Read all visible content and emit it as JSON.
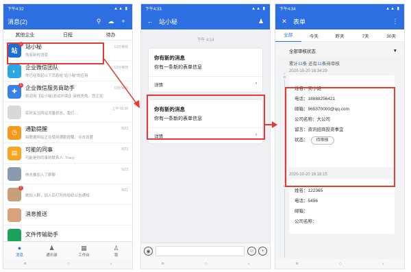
{
  "p1": {
    "status": {
      "time": "下午4:32"
    },
    "title": "消息(2)",
    "subbar": [
      "其他企业",
      "日程",
      "待办"
    ],
    "items": [
      {
        "name": "站小秘",
        "preview": "你有新的消息",
        "time": "13分钟前",
        "avatar": "站",
        "color": "#1a6fd6",
        "badge": "1"
      },
      {
        "name": "企业微信团队",
        "preview": "你已经发起以下消息给“站小秘”的应用",
        "time": "13分钟前",
        "avatar": "◐",
        "color": "#2aa6e0",
        "badge": ""
      },
      {
        "name": "企业微信服务商助手",
        "preview": "欢迎用【站小秘(测试环境)】审核失败，您正在",
        "time": "13分钟前",
        "avatar": "✚",
        "color": "#3b82e6",
        "badge": "1"
      },
      {
        "name": "",
        "preview": "实时关注网站流量状态，我们...",
        "time": "上午 11:36",
        "avatar": "",
        "color": "#d8d8d8",
        "badge": ""
      },
      {
        "name": "通勤提醒",
        "preview": "由数据网站正在使用通勤提醒，点击设置",
        "time": "9/23",
        "avatar": "◷",
        "color": "#f59a1b",
        "badge": ""
      },
      {
        "name": "可能的同事",
        "preview": "可能是你同事的联系人: Tracy",
        "time": "9/23",
        "avatar": "▤",
        "color": "#f5a623",
        "badge": ""
      },
      {
        "name": "",
        "preview": "林夫推加入了群聊",
        "time": "9/23",
        "avatar": "",
        "color": "#8a9bb0",
        "badge": ""
      },
      {
        "name": "",
        "preview": "她加入群，加入后打开的组织公告通知",
        "time": "9/21",
        "avatar": "",
        "color": "#c7a07a",
        "badge": "1"
      },
      {
        "name": "消息推送",
        "preview": "",
        "time": "",
        "avatar": "",
        "color": "#d9a27c",
        "badge": ""
      },
      {
        "name": "文件传输助手",
        "preview": "",
        "time": "",
        "avatar": "",
        "color": "#19a35b",
        "badge": ""
      }
    ],
    "tabs": [
      {
        "label": "消息",
        "icon": "●"
      },
      {
        "label": "通讯录",
        "icon": "♟"
      },
      {
        "label": "工作台",
        "icon": "▦"
      },
      {
        "label": "我",
        "icon": "♙"
      }
    ]
  },
  "p2": {
    "status": {
      "time": "下午4:33"
    },
    "title": "站小秘",
    "time": "下午 4:14",
    "cards": [
      {
        "title": "你有新的消息",
        "desc": "你有一条新的表单信息",
        "detail": "详情"
      },
      {
        "title": "你有新的消息",
        "desc": "你有一条新的表单信息",
        "detail": "详情"
      }
    ]
  },
  "p3": {
    "status": {
      "time": "下午4:34"
    },
    "title": "表单",
    "tabs": [
      "全部",
      "今天",
      "昨天",
      "7天",
      "30天"
    ],
    "filter": "全部审核状态",
    "count_prefix": "累计",
    "count_total": "11",
    "count_mid": "条 还有",
    "count_pending": "11",
    "count_suffix": "条待审核",
    "records": [
      {
        "date": "2020-10-20 16:34:29",
        "rows": [
          "姓名：吴小姐",
          "电话：18688256421",
          "邮箱：965370000@qq.com",
          "公司名称：大公司",
          "留言：资讯招商投资事宜"
        ],
        "status_label": "状态：",
        "status_btn": "待审核"
      },
      {
        "date": "2020-10-20 16:18:15",
        "rows": [
          "姓名：122365",
          "电话：5456",
          "邮箱：",
          "公司名称："
        ],
        "status_label": "",
        "status_btn": ""
      }
    ]
  },
  "nav": [
    "≡",
    "○",
    "‹"
  ]
}
